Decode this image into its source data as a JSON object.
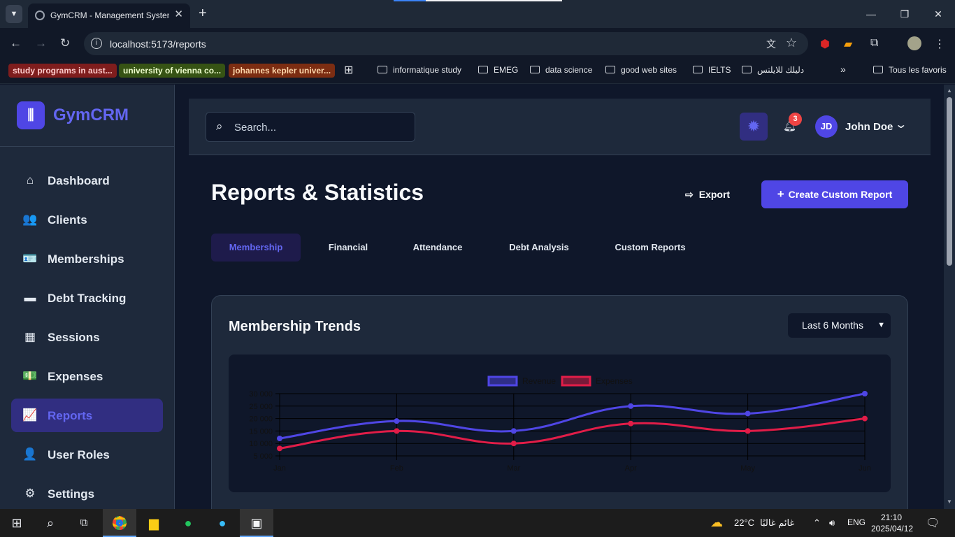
{
  "browser": {
    "tab_title": "GymCRM - Management System",
    "url": "localhost:5173/reports",
    "bookmarks_chips": [
      {
        "label": "study programs in aust...",
        "bg": "#7f1d1d",
        "fg": "#fecaca"
      },
      {
        "label": "university of vienna co...",
        "bg": "#365314",
        "fg": "#ecfccb"
      },
      {
        "label": "johannes kepler univer...",
        "bg": "#7c2d12",
        "fg": "#fed7aa"
      }
    ],
    "bookmarks": [
      "informatique study",
      "EMEG",
      "data science",
      "good web sites",
      "IELTS",
      "دليلك للايلتس"
    ],
    "all_bookmarks": "Tous les favoris",
    "more": "»"
  },
  "sidebar": {
    "logo_glyph": "⫼",
    "brand": "GymCRM",
    "items": [
      {
        "label": "Dashboard",
        "icon": "⌂",
        "icon_name": "home-icon"
      },
      {
        "label": "Clients",
        "icon": "👥",
        "icon_name": "users-icon"
      },
      {
        "label": "Memberships",
        "icon": "🪪",
        "icon_name": "id-card-icon"
      },
      {
        "label": "Debt Tracking",
        "icon": "▬",
        "icon_name": "credit-card-icon"
      },
      {
        "label": "Sessions",
        "icon": "▦",
        "icon_name": "calendar-icon"
      },
      {
        "label": "Expenses",
        "icon": "💵",
        "icon_name": "money-icon"
      },
      {
        "label": "Reports",
        "icon": "📈",
        "icon_name": "chart-line-icon"
      },
      {
        "label": "User Roles",
        "icon": "👤",
        "icon_name": "user-lock-icon"
      },
      {
        "label": "Settings",
        "icon": "⚙",
        "icon_name": "gear-icon"
      }
    ],
    "active_index": 6
  },
  "topbar": {
    "search_placeholder": "Search...",
    "notifications": "3",
    "avatar_initials": "JD",
    "user_name": "John Doe"
  },
  "page": {
    "title": "Reports & Statistics",
    "export_label": "Export",
    "create_label": "Create Custom Report",
    "tabs": [
      "Membership",
      "Financial",
      "Attendance",
      "Debt Analysis",
      "Custom Reports"
    ],
    "active_tab": 0
  },
  "card": {
    "title": "Membership Trends",
    "period": "Last 6 Months"
  },
  "chart_data": {
    "type": "line",
    "categories": [
      "Jan",
      "Feb",
      "Mar",
      "Apr",
      "May",
      "Jun"
    ],
    "series": [
      {
        "name": "Revenue",
        "values": [
          12000,
          19000,
          15000,
          25000,
          22000,
          30000
        ],
        "color": "#4f46e5"
      },
      {
        "name": "Expenses",
        "values": [
          8000,
          15000,
          10000,
          18000,
          15000,
          20000
        ],
        "color": "#e11d48"
      }
    ],
    "y_ticks": [
      "30 000",
      "25 000",
      "20 000",
      "15 000",
      "10 000",
      "5 000"
    ],
    "ylim": [
      5000,
      30000
    ],
    "grid": true,
    "legend": "top-center"
  },
  "taskbar": {
    "weather_temp": "22°C",
    "weather_text": "غائم غالبًا",
    "lang": "ENG",
    "time": "21:10",
    "date": "2025/04/12"
  }
}
